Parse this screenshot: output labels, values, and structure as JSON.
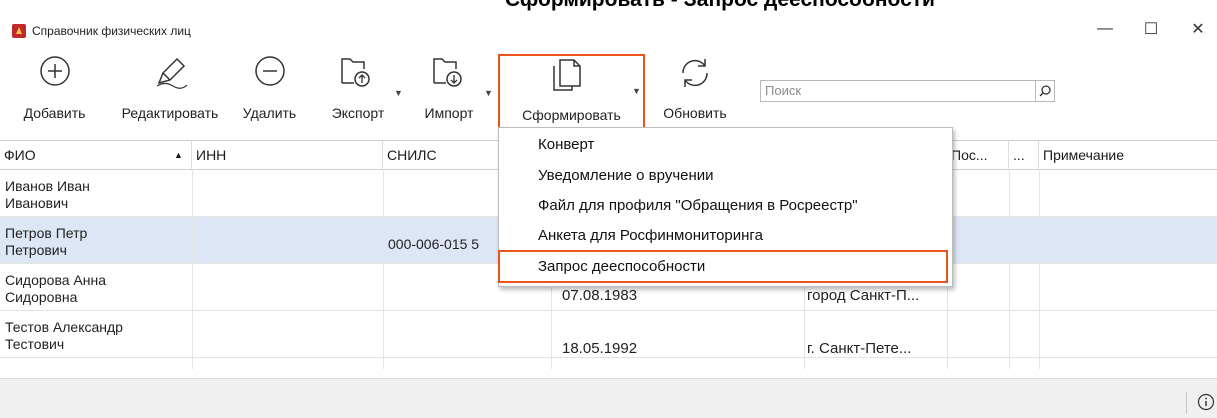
{
  "header_fragment": "Сформировать - Запрос дееспособности",
  "window": {
    "title": "Справочник физических лиц",
    "controls": {
      "minimize": "—",
      "maximize": "☐",
      "close": "✕"
    }
  },
  "toolbar": {
    "add": "Добавить",
    "edit": "Редактировать",
    "delete": "Удалить",
    "export": "Экспорт",
    "import": "Импорт",
    "generate": "Сформировать",
    "refresh": "Обновить",
    "search_placeholder": "Поиск"
  },
  "columns": [
    "ФИО",
    "ИНН",
    "СНИЛС",
    "Пос...",
    "...",
    "Примечание"
  ],
  "rows": [
    {
      "fio": "Иванов Иван Иванович",
      "fio1": "Иванов Иван",
      "fio2": "Иванович",
      "inn": "",
      "snils": "",
      "date": "",
      "place": ""
    },
    {
      "fio": "Петров Петр Петрович",
      "fio1": "Петров Петр",
      "fio2": "Петрович",
      "inn": "",
      "snils": "000-006-015 5",
      "date": "",
      "place": ""
    },
    {
      "fio": "Сидорова Анна Сидоровна",
      "fio1": "Сидорова Анна",
      "fio2": "Сидоровна",
      "inn": "",
      "snils": "",
      "date": "07.08.1983",
      "place": "город Санкт-П..."
    },
    {
      "fio": "Тестов Александр Тестович",
      "fio1": "Тестов Александр",
      "fio2": "Тестович",
      "inn": "",
      "snils": "",
      "date": "18.05.1992",
      "place": "г. Санкт-Пете..."
    }
  ],
  "menu": {
    "items": [
      "Конверт",
      "Уведомление о вручении",
      "Файл для профиля \"Обращения в Росреестр\"",
      "Анкета для Росфинмониторинга",
      "Запрос дееспособности"
    ]
  },
  "colors": {
    "highlight": "#e8541c",
    "selected_row": "#dde6f5",
    "app_icon": "#c0282e"
  },
  "icons": [
    "plus-circle-icon",
    "pencil-icon",
    "minus-circle-icon",
    "export-icon",
    "import-icon",
    "document-icon",
    "refresh-icon",
    "search-icon",
    "info-icon"
  ]
}
